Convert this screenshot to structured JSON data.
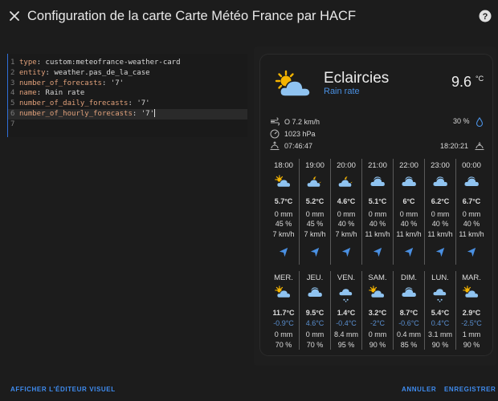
{
  "header": {
    "title": "Configuration de la carte Carte Météo France par HACF"
  },
  "editor": {
    "lines": [
      {
        "num": "1",
        "key": "type",
        "value": "custom:meteofrance-weather-card"
      },
      {
        "num": "2",
        "key": "entity",
        "value": "weather.pas_de_la_case"
      },
      {
        "num": "3",
        "key": "number_of_forecasts",
        "value": "'7'"
      },
      {
        "num": "4",
        "key": "name",
        "value": "Rain rate"
      },
      {
        "num": "5",
        "key": "number_of_daily_forecasts",
        "value": "'7'"
      },
      {
        "num": "6",
        "key": "number_of_hourly_forecasts",
        "value": "'7'"
      },
      {
        "num": "7",
        "key": "",
        "value": ""
      }
    ]
  },
  "card": {
    "condition": "Eclaircies",
    "name": "Rain rate",
    "temperature": "9.6",
    "temperature_unit": "°C",
    "wind": "O 7.2 km/h",
    "pressure": "1023 hPa",
    "sunrise": "07:46:47",
    "sunset": "18:20:21",
    "precip_probability": "30 %",
    "hourly": [
      {
        "time": "18:00",
        "icon": "partly-cloudy-day-icon",
        "temp": "5.7°C",
        "rain": "0 mm",
        "prob": "45 %",
        "wind": "7 km/h"
      },
      {
        "time": "19:00",
        "icon": "partly-cloudy-night-icon",
        "temp": "5.2°C",
        "rain": "0 mm",
        "prob": "45 %",
        "wind": "7 km/h"
      },
      {
        "time": "20:00",
        "icon": "partly-cloudy-night-icon",
        "temp": "4.6°C",
        "rain": "0 mm",
        "prob": "40 %",
        "wind": "7 km/h"
      },
      {
        "time": "21:00",
        "icon": "cloudy-icon",
        "temp": "5.1°C",
        "rain": "0 mm",
        "prob": "40 %",
        "wind": "11 km/h"
      },
      {
        "time": "22:00",
        "icon": "cloudy-icon",
        "temp": "6°C",
        "rain": "0 mm",
        "prob": "40 %",
        "wind": "11 km/h"
      },
      {
        "time": "23:00",
        "icon": "cloudy-icon",
        "temp": "6.2°C",
        "rain": "0 mm",
        "prob": "40 %",
        "wind": "11 km/h"
      },
      {
        "time": "00:00",
        "icon": "cloudy-icon",
        "temp": "6.7°C",
        "rain": "0 mm",
        "prob": "40 %",
        "wind": "11 km/h"
      }
    ],
    "daily": [
      {
        "day": "MER.",
        "icon": "partly-cloudy-day-icon",
        "high": "11.7°C",
        "low": "-0.9°C",
        "rain": "0 mm",
        "prob": "70 %"
      },
      {
        "day": "JEU.",
        "icon": "cloudy-icon",
        "high": "9.5°C",
        "low": "4.6°C",
        "rain": "0 mm",
        "prob": "70 %"
      },
      {
        "day": "VEN.",
        "icon": "snowy-icon",
        "high": "1.4°C",
        "low": "-0.4°C",
        "rain": "8.4 mm",
        "prob": "95 %"
      },
      {
        "day": "SAM.",
        "icon": "partly-cloudy-day-icon",
        "high": "3.2°C",
        "low": "-2°C",
        "rain": "0 mm",
        "prob": "90 %"
      },
      {
        "day": "DIM.",
        "icon": "cloudy-icon",
        "high": "8.7°C",
        "low": "-0.6°C",
        "rain": "0.4 mm",
        "prob": "85 %"
      },
      {
        "day": "LUN.",
        "icon": "snowy-icon",
        "high": "5.4°C",
        "low": "0.4°C",
        "rain": "3.1 mm",
        "prob": "90 %"
      },
      {
        "day": "MAR.",
        "icon": "partly-cloudy-day-icon",
        "high": "2.9°C",
        "low": "-2.5°C",
        "rain": "1 mm",
        "prob": "90 %"
      }
    ]
  },
  "footer": {
    "show_visual_editor": "AFFICHER L'ÉDITEUR VISUEL",
    "cancel": "ANNULER",
    "save": "ENREGISTRER"
  },
  "colors": {
    "accent": "#3f8cf0",
    "cloud": "#8fc3f0",
    "sun": "#f5b400",
    "low_temp": "#5a8fd0"
  }
}
